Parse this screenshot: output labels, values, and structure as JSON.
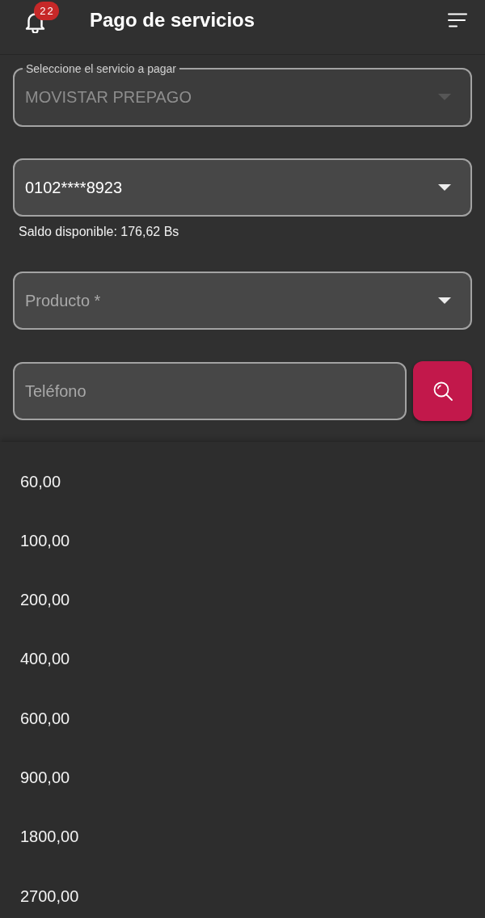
{
  "header": {
    "notification_count": "22",
    "title": "Pago de servicios"
  },
  "form": {
    "fields": [
      {
        "kind": "select",
        "label": "Seleccione el servicio a pagar",
        "value": "MOVISTAR PREPAGO",
        "disabled": true
      },
      {
        "kind": "select",
        "value": "0102****8923",
        "helper": "Saldo disponible: 176,62 Bs",
        "disabled": false
      },
      {
        "kind": "select",
        "placeholder": "Producto *",
        "disabled": false
      },
      {
        "kind": "search-input",
        "placeholder": "Teléfono",
        "disabled": false
      }
    ]
  },
  "options": [
    {
      "label": "60,00",
      "selected": false
    },
    {
      "label": "100,00",
      "selected": false
    },
    {
      "label": "200,00",
      "selected": false
    },
    {
      "label": "400,00",
      "selected": false
    },
    {
      "label": "600,00",
      "selected": false
    },
    {
      "label": "900,00",
      "selected": false
    },
    {
      "label": "1800,00",
      "selected": false
    },
    {
      "label": "2700,00",
      "selected": false
    }
  ]
}
